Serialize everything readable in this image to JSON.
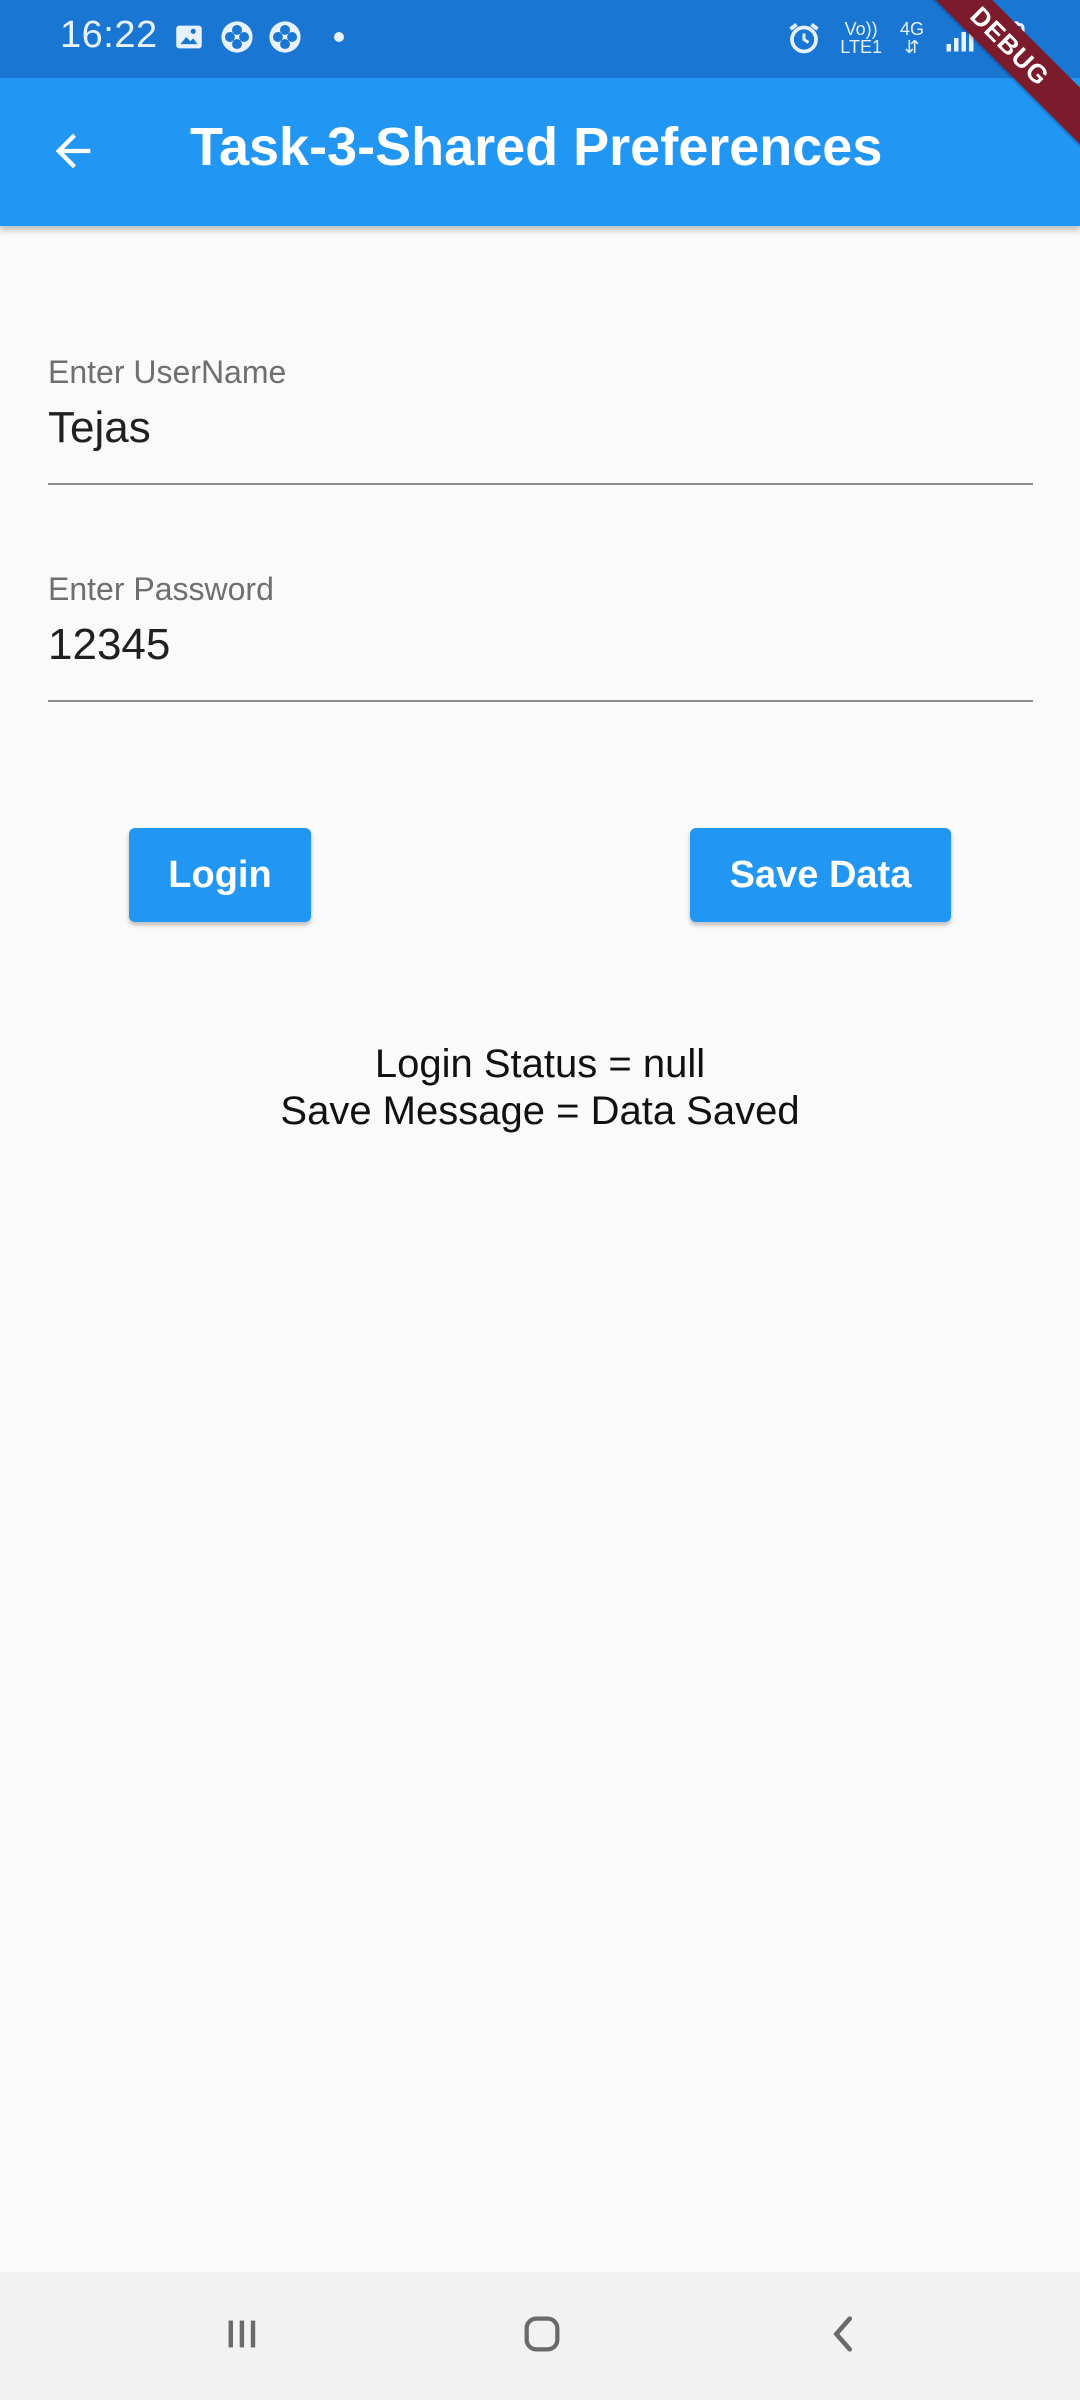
{
  "status_bar": {
    "time": "16:22",
    "left_icons": [
      "gallery-icon",
      "fan-icon",
      "fan-icon"
    ],
    "right_icons": [
      "alarm-icon",
      "volte-icon",
      "4g-icon",
      "signal-icon",
      "battery-icon"
    ],
    "network": {
      "line1": "Vo))",
      "line2": "LTE1",
      "type": "4G"
    }
  },
  "debug_ribbon": "DEBUG",
  "app_bar": {
    "title": "Task-3-Shared Preferences",
    "back_icon": "arrow-back-icon"
  },
  "form": {
    "username": {
      "label": "Enter UserName",
      "value": "Tejas"
    },
    "password": {
      "label": "Enter Password",
      "value": "12345"
    }
  },
  "buttons": {
    "login": "Login",
    "save": "Save Data"
  },
  "status": {
    "login_status": "Login Status = null",
    "save_message": "Save Message = Data Saved"
  },
  "nav_bar": {
    "recent": "recent-apps-icon",
    "home": "home-icon",
    "back": "nav-back-icon"
  },
  "colors": {
    "primary": "#2196f3",
    "status_bar": "#1976d2",
    "background": "#fafafa",
    "debug": "#7b1b2b"
  }
}
